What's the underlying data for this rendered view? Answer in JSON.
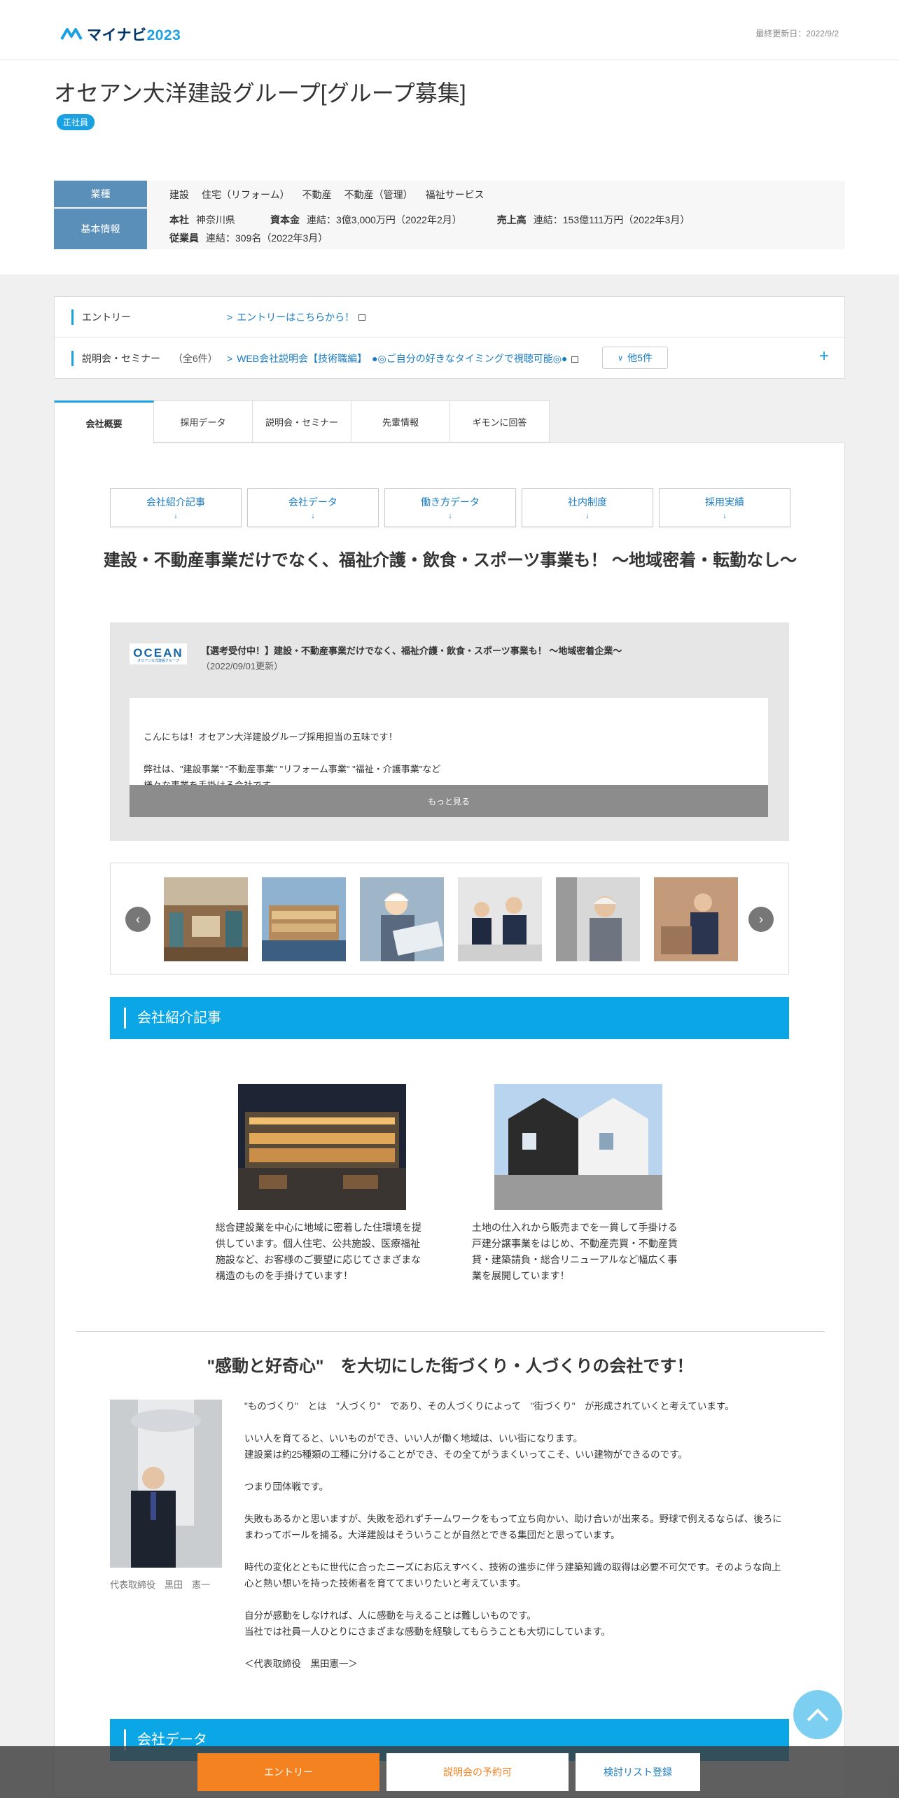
{
  "header": {
    "logo_text": "マイナビ",
    "logo_year": "2023",
    "updated": "最終更新日：2022/9/2"
  },
  "company": {
    "name": "オセアン大洋建設グループ[グループ募集]",
    "badge": "正社員"
  },
  "info": {
    "industry_label": "業種",
    "industries": [
      "建設",
      "住宅（リフォーム）",
      "不動産",
      "不動産（管理）",
      "福祉サービス"
    ],
    "basic_label": "基本情報",
    "hq_label": "本社",
    "hq": "神奈川県",
    "capital_label": "資本金",
    "capital": "連結：3億3,000万円（2022年2月）",
    "sales_label": "売上高",
    "sales": "連結：153億111万円（2022年3月）",
    "employees_label": "従業員",
    "employees": "連結：309名（2022年3月）"
  },
  "entry": {
    "label": "エントリー",
    "link": "エントリーはこちらから！",
    "seminar_label": "説明会・セミナー",
    "seminar_count": "（全6件）",
    "seminar_link": "WEB会社説明会【技術職編】　●◎ご自分の好きなタイミングで視聴可能◎●",
    "more": "他5件",
    "plus": "+"
  },
  "tabs": [
    "会社概要",
    "採用データ",
    "説明会・セミナー",
    "先輩情報",
    "ギモンに回答"
  ],
  "anchors": [
    "会社紹介記事",
    "会社データ",
    "働き方データ",
    "社内制度",
    "採用実績"
  ],
  "anchor_arrow": "↓",
  "main_heading": "建設・不動産事業だけでなく、福祉介護・飲食・スポーツ事業も！ ～地域密着・転勤なし～",
  "news": {
    "logo": "OCEAN",
    "logo_sub": "オセアン大洋建設グループ",
    "title": "【選考受付中！】建設・不動産事業だけでなく、福祉介護・飲食・スポーツ事業も！ ～地域密着企業～",
    "date": "（2022/09/01更新）",
    "body": "こんにちは！オセアン大洋建設グループ採用担当の五味です！\n\n弊社は、\"建設事業\" \"不動産事業\" \"リフォーム事業\" \"福祉・介護事業\"など\n様々な事業を手掛ける会社です。\n\n（・・・【技術職】【営業職】【介護職】選考受付中！・・・）",
    "more": "もっと見る"
  },
  "slider": {
    "prev": "‹",
    "next": "›"
  },
  "section_intro": "会社紹介記事",
  "articles": [
    "総合建設業を中心に地域に密着した住環境を提供しています。個人住宅、公共施設、医療福祉施設など、お客様のご要望に応じてさまざまな構造のものを手掛けています！",
    "土地の仕入れから販売までを一貫して手掛ける戸建分譲事業をはじめ、不動産売買・不動産賃貸・建築請負・総合リニューアルなど幅広く事業を展開しています！"
  ],
  "message": {
    "heading": "\"感動と好奇心\"　を大切にした街づくり・人づくりの会社です！",
    "caption": "代表取締役　黒田　憲一",
    "paragraphs": [
      "\"ものづくり\"　とは　\"人づくり\"　であり、その人づくりによって　\"街づくり\"　が形成されていくと考えています。",
      "いい人を育てると、いいものができ、いい人が働く地域は、いい街になります。\n建設業は約25種類の工種に分けることができ、その全てがうまくいってこそ、いい建物ができるのです。",
      "つまり団体戦です。",
      "失敗もあるかと思いますが、失敗を恐れずチームワークをもって立ち向かい、助け合いが出来る。野球で例えるならば、後ろにまわってボールを捕る。大洋建設はそういうことが自然とできる集団だと思っています。",
      "時代の変化とともに世代に合ったニーズにお応えすべく、技術の進歩に伴う建築知識の取得は必要不可欠です。そのような向上心と熱い想いを持った技術者を育ててまいりたいと考えています。",
      "自分が感動をしなければ、人に感動を与えることは難しいものです。\n当社では社員一人ひとりにさまざまな感動を経験してもらうことも大切にしています。",
      "＜代表取締役　黒田憲一＞"
    ]
  },
  "section_data": "会社データ",
  "bottom": {
    "entry": "エントリー",
    "seminar": "説明会の予約可",
    "list": "検討リスト登録"
  },
  "colors": {
    "accent": "#0ba6e6",
    "orange": "#f58220",
    "navy": "#5a8fba"
  }
}
